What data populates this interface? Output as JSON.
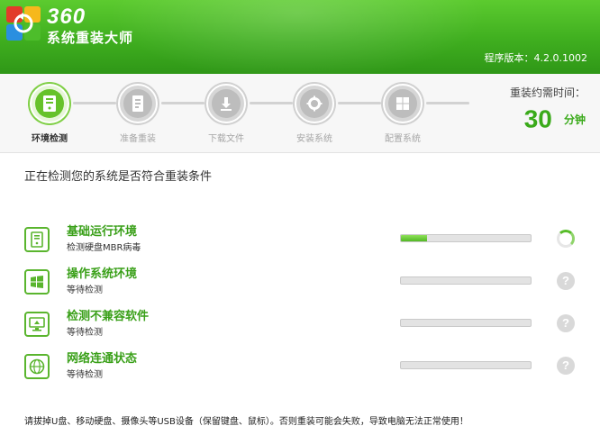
{
  "header": {
    "brand": "360",
    "product": "系统重装大师",
    "version_label": "程序版本：4.2.0.1002",
    "logo": "360-logo"
  },
  "steps": [
    {
      "label": "环境检测",
      "icon": "computer-icon",
      "active": true
    },
    {
      "label": "准备重装",
      "icon": "document-icon",
      "active": false
    },
    {
      "label": "下载文件",
      "icon": "download-icon",
      "active": false
    },
    {
      "label": "安装系统",
      "icon": "gear-icon",
      "active": false
    },
    {
      "label": "配置系统",
      "icon": "windows-icon",
      "active": false
    }
  ],
  "time": {
    "title": "重装约需时间：",
    "value": "30",
    "unit": "分钟"
  },
  "main": {
    "heading": "正在检测您的系统是否符合重装条件",
    "checks": [
      {
        "title": "基础运行环境",
        "status": "检测硬盘MBR病毒",
        "progress": 0.2,
        "state": "running",
        "icon": "computer-icon"
      },
      {
        "title": "操作系统环境",
        "status": "等待检测",
        "progress": 0,
        "state": "waiting",
        "icon": "windows-icon"
      },
      {
        "title": "检测不兼容软件",
        "status": "等待检测",
        "progress": 0,
        "state": "waiting",
        "icon": "monitor-icon"
      },
      {
        "title": "网络连通状态",
        "status": "等待检测",
        "progress": 0,
        "state": "waiting",
        "icon": "globe-icon"
      }
    ],
    "warning": "请拔掉U盘、移动硬盘、摄像头等USB设备（保留键盘、鼠标）。否则重装可能会失败，导致电脑无法正常使用！"
  },
  "colors": {
    "accent": "#3aaa1a",
    "header_top": "#5ccb2f",
    "header_bottom": "#2f9717",
    "inactive": "#bdbdbd"
  }
}
